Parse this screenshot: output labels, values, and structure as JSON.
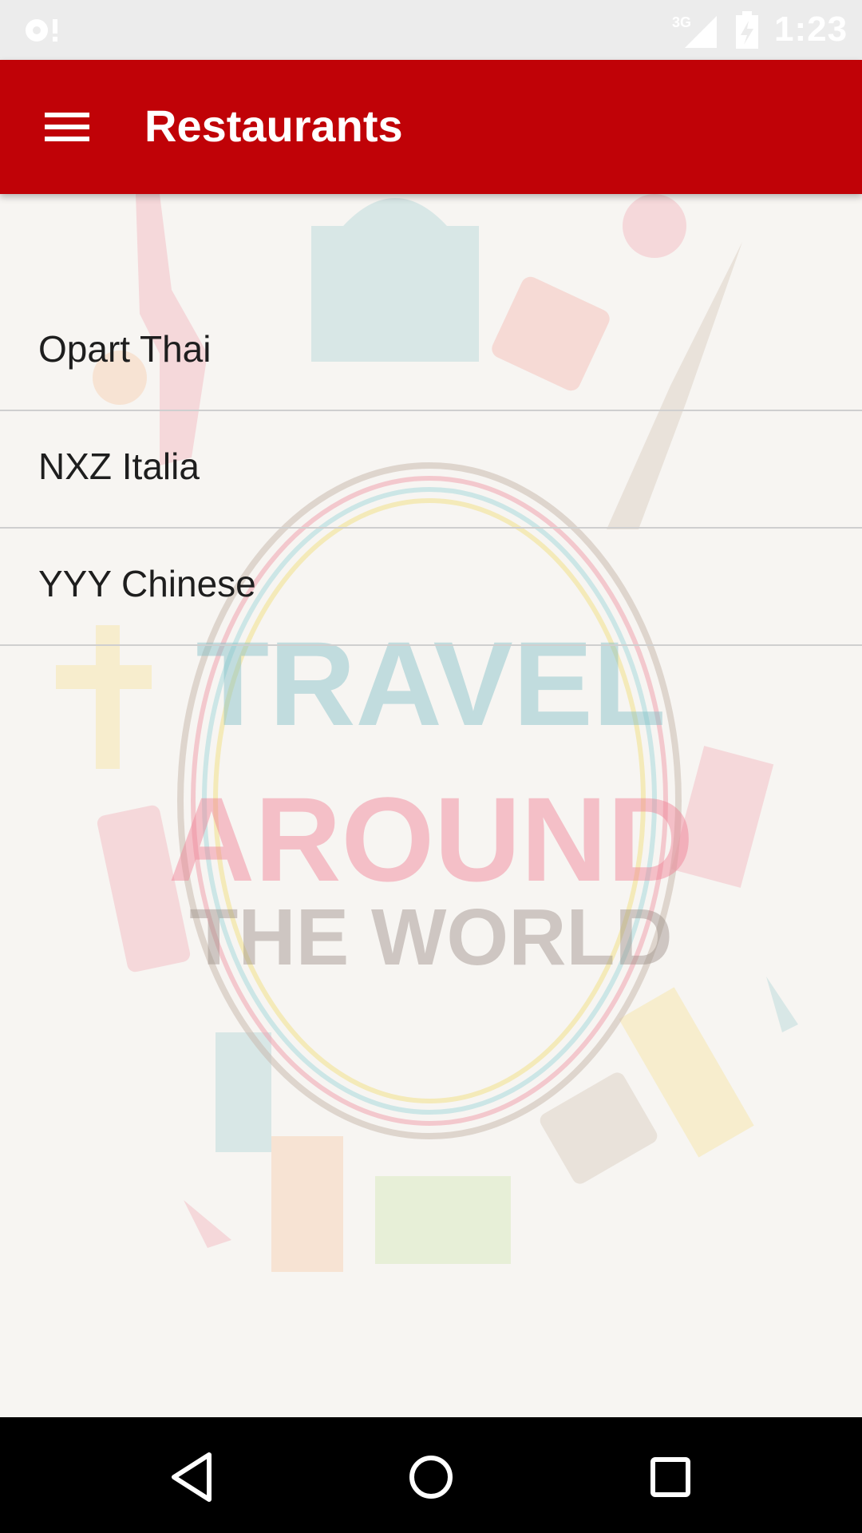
{
  "status_bar": {
    "time": "1:23",
    "network": "3G",
    "icons": [
      "notification-icon",
      "signal-3g-icon",
      "battery-icon"
    ]
  },
  "app_bar": {
    "title": "Restaurants",
    "menu_icon": "hamburger-menu-icon",
    "color": "#c00207"
  },
  "background": {
    "line1": "TRAVEL",
    "line2": "AROUND",
    "line3": "THE WORLD"
  },
  "restaurants": [
    {
      "name": "Opart Thai"
    },
    {
      "name": "NXZ Italia"
    },
    {
      "name": "YYY Chinese"
    }
  ],
  "nav_bar": {
    "icons": [
      "back-icon",
      "home-icon",
      "recents-icon"
    ]
  }
}
